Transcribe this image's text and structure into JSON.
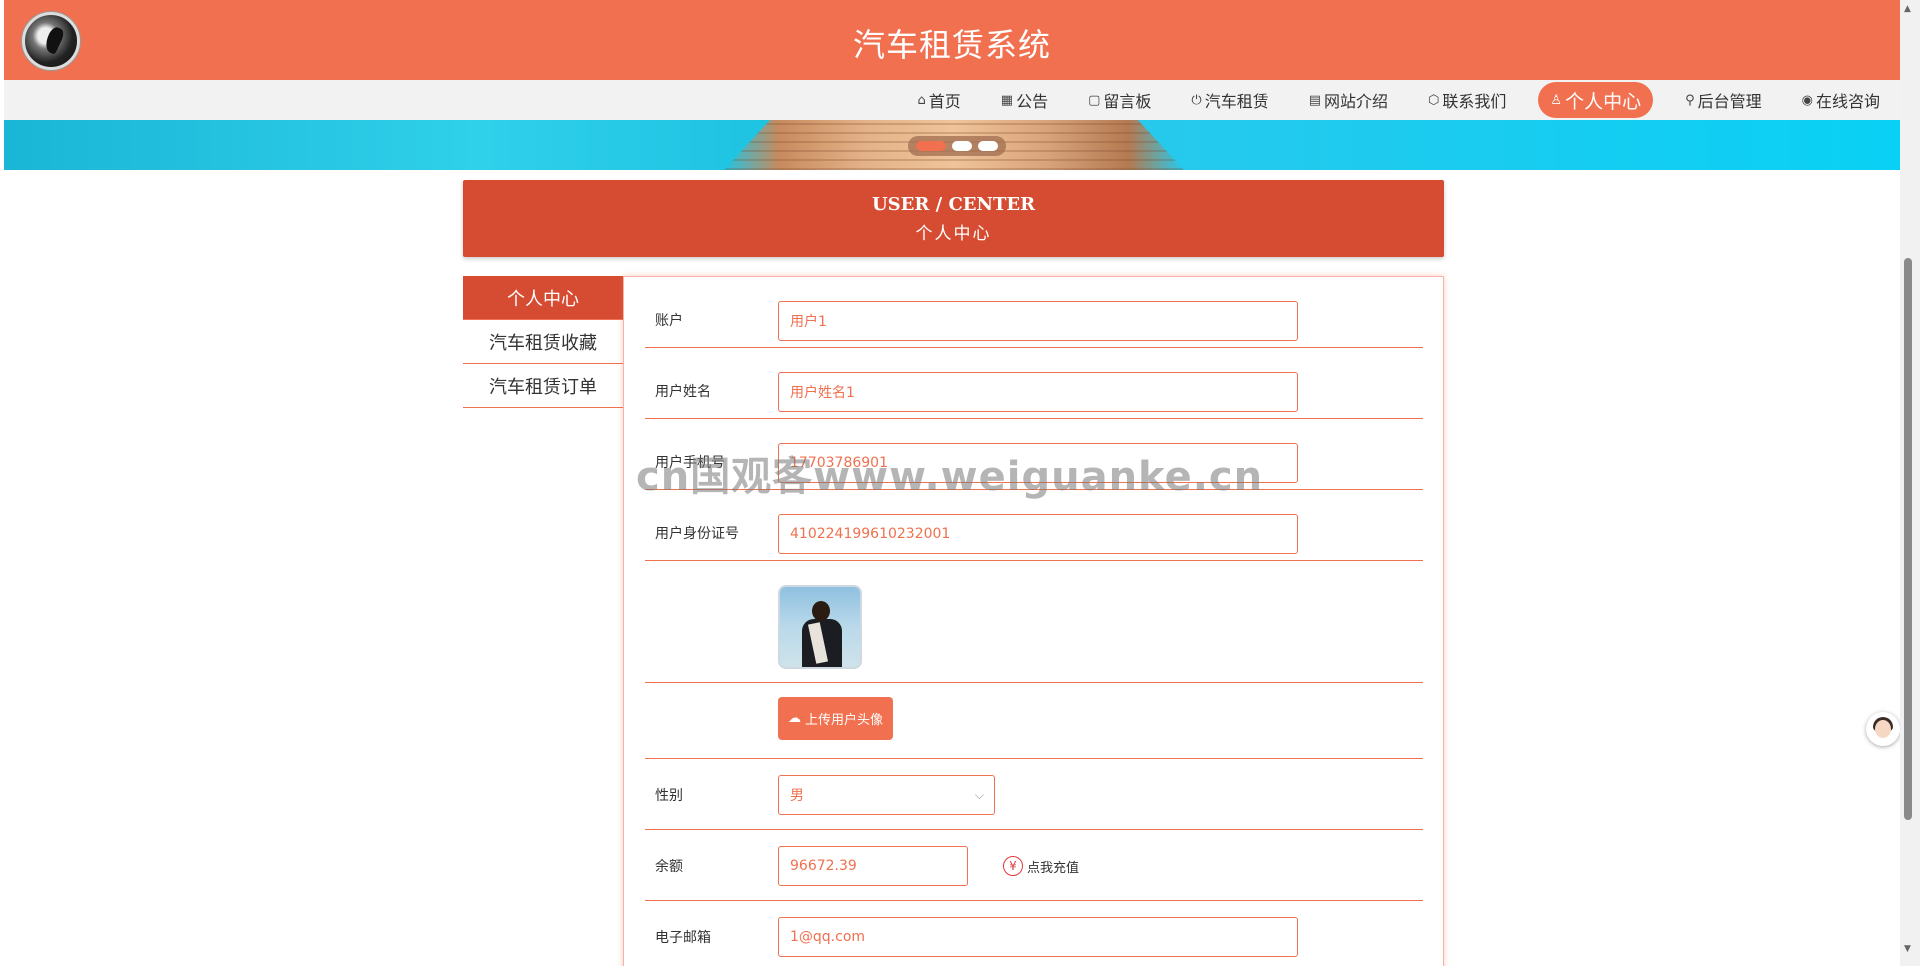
{
  "header": {
    "title": "汽车租赁系统",
    "logo_icon": "logo-icon"
  },
  "nav": {
    "items": [
      {
        "icon": "home-icon",
        "glyph": "⌂",
        "label": "首页"
      },
      {
        "icon": "notice-icon",
        "glyph": "▦",
        "label": "公告"
      },
      {
        "icon": "note-icon",
        "glyph": "▢",
        "label": "留言板"
      },
      {
        "icon": "power-icon",
        "glyph": "⏻",
        "label": "汽车租赁"
      },
      {
        "icon": "gift-icon",
        "glyph": "▤",
        "label": "网站介绍"
      },
      {
        "icon": "cube-icon",
        "glyph": "⬡",
        "label": "联系我们"
      },
      {
        "icon": "user-icon",
        "glyph": "♙",
        "label": "个人中心",
        "active": true
      },
      {
        "icon": "link-icon",
        "glyph": "⚲",
        "label": "后台管理"
      },
      {
        "icon": "chat-icon",
        "glyph": "◉",
        "label": "在线咨询"
      }
    ]
  },
  "banner": {
    "dots": 3,
    "active_dot": 0
  },
  "section": {
    "en": "USER / CENTER",
    "zh": "个人中心"
  },
  "sidebar": {
    "items": [
      {
        "label": "个人中心",
        "active": true
      },
      {
        "label": "汽车租赁收藏"
      },
      {
        "label": "汽车租赁订单"
      }
    ]
  },
  "form": {
    "account_label": "账户",
    "account_value": "用户1",
    "name_label": "用户姓名",
    "name_value": "用户姓名1",
    "phone_label": "用户手机号",
    "phone_value": "17703786901",
    "idcard_label": "用户身份证号",
    "idcard_value": "410224199610232001",
    "upload_label": "上传用户头像",
    "gender_label": "性别",
    "gender_value": "男",
    "balance_label": "余额",
    "balance_value": "96672.39",
    "recharge_label": "点我充值",
    "email_label": "电子邮箱",
    "email_value": "1@qq.com"
  },
  "watermark": "cn国观客www.weiguanke.cn",
  "colors": {
    "primary": "#f07050",
    "dark_primary": "#d64c32"
  }
}
